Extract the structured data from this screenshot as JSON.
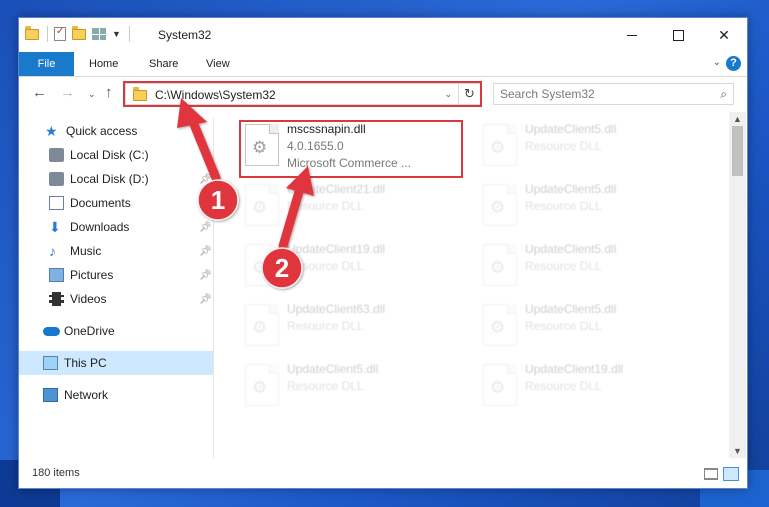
{
  "window": {
    "title": "System32"
  },
  "ribbon": {
    "tabs": [
      {
        "label": "File"
      },
      {
        "label": "Home"
      },
      {
        "label": "Share"
      },
      {
        "label": "View"
      }
    ],
    "help_symbol": "?"
  },
  "address_bar": {
    "path": "C:\\Windows\\System32",
    "refresh_icon": "refresh-icon",
    "dropdown_icon": "chevron-down-icon"
  },
  "search": {
    "placeholder": "Search System32"
  },
  "sidebar": {
    "items": [
      {
        "label": "Quick access",
        "icon": "star-icon",
        "pinned": false
      },
      {
        "label": "Local Disk (C:)",
        "icon": "drive-icon",
        "pinned": false
      },
      {
        "label": "Local Disk (D:)",
        "icon": "drive-icon",
        "pinned": true
      },
      {
        "label": "Documents",
        "icon": "documents-icon",
        "pinned": true
      },
      {
        "label": "Downloads",
        "icon": "downloads-icon",
        "pinned": true
      },
      {
        "label": "Music",
        "icon": "music-icon",
        "pinned": true
      },
      {
        "label": "Pictures",
        "icon": "pictures-icon",
        "pinned": true
      },
      {
        "label": "Videos",
        "icon": "videos-icon",
        "pinned": true
      },
      {
        "label": "OneDrive",
        "icon": "cloud-icon",
        "pinned": false
      },
      {
        "label": "This PC",
        "icon": "computer-icon",
        "pinned": false,
        "selected": true
      },
      {
        "label": "Network",
        "icon": "network-icon",
        "pinned": false
      }
    ]
  },
  "files": {
    "featured": {
      "name": "mscssnapin.dll",
      "version": "4.0.1655.0",
      "description": "Microsoft Commerce ..."
    },
    "background_tiles": [
      {
        "name": "UpdateClient5.dll",
        "type": "Resource DLL"
      },
      {
        "name": "UpdateClient21.dll",
        "type": "Resource DLL"
      },
      {
        "name": "UpdateClient5.dll",
        "type": "Resource DLL"
      },
      {
        "name": "UpdateClient19.dll",
        "type": "Resource DLL"
      },
      {
        "name": "UpdateClient5.dll",
        "type": "Resource DLL"
      },
      {
        "name": "UpdateClient63.dll",
        "type": "Resource DLL"
      },
      {
        "name": "UpdateClient5.dll",
        "type": "Resource DLL"
      },
      {
        "name": "UpdateClient5.dll",
        "type": "Resource DLL"
      },
      {
        "name": "UpdateClient19.dll",
        "type": "Resource DLL"
      }
    ]
  },
  "status_bar": {
    "item_count": "180 items"
  },
  "annotations": {
    "step1": "1",
    "step2": "2",
    "arrow_color": "#e0363c"
  },
  "colors": {
    "accent": "#1979ca",
    "highlight": "#d9393e",
    "selection": "#cde8ff"
  }
}
